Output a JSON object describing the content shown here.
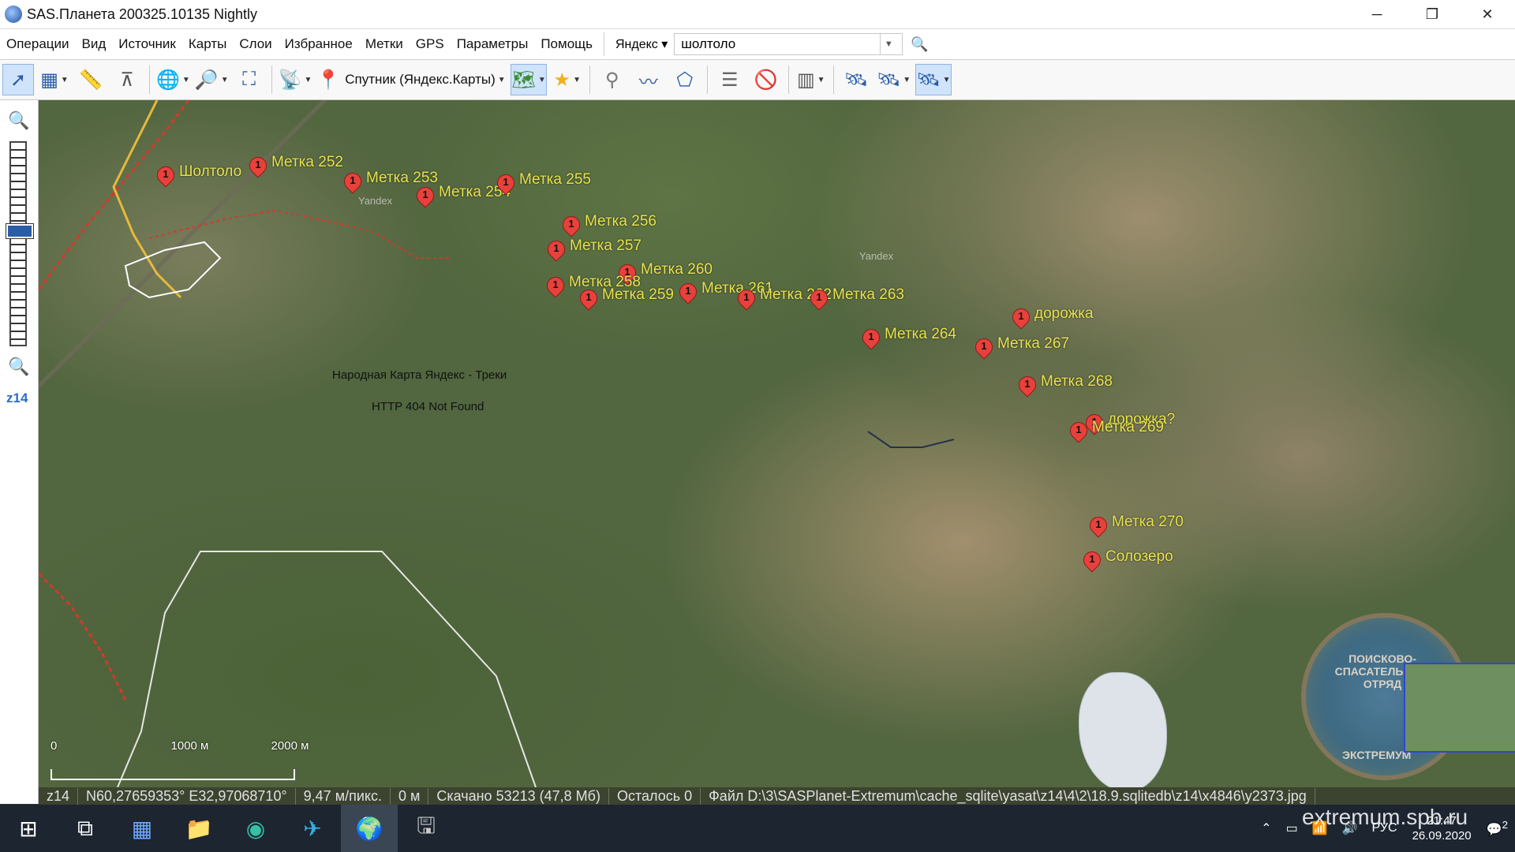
{
  "window": {
    "title": "SAS.Планета 200325.10135 Nightly",
    "minimize": "─",
    "restore": "❐",
    "close": "✕"
  },
  "menu": {
    "items": [
      "Операции",
      "Вид",
      "Источник",
      "Карты",
      "Слои",
      "Избранное",
      "Метки",
      "GPS",
      "Параметры",
      "Помощь"
    ]
  },
  "search": {
    "provider": "Яндекс",
    "value": "шолтоло",
    "go_icon": "🔍"
  },
  "toolbar": {
    "map_source": "Спутник (Яндекс.Карты)"
  },
  "zoom": {
    "level_label": "z14",
    "zoom_in": "🔍",
    "zoom_out": "🔍"
  },
  "map": {
    "overlay_text_1": "Народная Карта Яндекс - Треки",
    "overlay_text_2": "HTTP 404 Not Found",
    "watermark_1": "Yandex",
    "watermark_2": "Yandex",
    "scale": {
      "zero": "0",
      "mid": "1000 м",
      "end": "2000 м"
    },
    "emblem_top": "ПОИСКОВО-СПАСАТЕЛЬНЫЙ ОТРЯД",
    "emblem_bottom": "ЭКСТРЕМУМ",
    "markers": [
      {
        "pin": "1",
        "label": "Шолтоло"
      },
      {
        "pin": "1",
        "label": "Метка 252"
      },
      {
        "pin": "1",
        "label": "Метка 253"
      },
      {
        "pin": "1",
        "label": "Метка 254"
      },
      {
        "pin": "1",
        "label": "Метка 255"
      },
      {
        "pin": "1",
        "label": "Метка 256"
      },
      {
        "pin": "1",
        "label": "Метка 257"
      },
      {
        "pin": "1",
        "label": "Метка 260"
      },
      {
        "pin": "1",
        "label": "Метка 258"
      },
      {
        "pin": "1",
        "label": "Метка 259"
      },
      {
        "pin": "1",
        "label": "Метка 261"
      },
      {
        "pin": "1",
        "label": "Метка 262"
      },
      {
        "pin": "1",
        "label": "Метка 263"
      },
      {
        "pin": "1",
        "label": "дорожка"
      },
      {
        "pin": "1",
        "label": "Метка 264"
      },
      {
        "pin": "1",
        "label": "Метка 267"
      },
      {
        "pin": "1",
        "label": "Метка 268"
      },
      {
        "pin": "1",
        "label": "дорожка?"
      },
      {
        "pin": "1",
        "label": "Метка 269"
      },
      {
        "pin": "1",
        "label": "Метка 270"
      },
      {
        "pin": "1",
        "label": "Солозеро"
      }
    ]
  },
  "status": {
    "zoom": "z14",
    "coords": "N60,27659353° E32,97068710°",
    "resolution": "9,47 м/пикс.",
    "distance": "0 м",
    "downloaded": "Скачано 53213 (47,8 Мб)",
    "remaining": "Осталось 0",
    "file": "Файл D:\\3\\SASPlanet-Extremum\\cache_sqlite\\yasat\\z14\\4\\2\\18.9.sqlitedb\\z14\\x4846\\y2373.jpg"
  },
  "taskbar": {
    "apps": [
      "start-icon",
      "task-view-icon",
      "calculator-icon",
      "file-explorer-icon",
      "edge-icon",
      "telegram-icon",
      "sasplanet-icon",
      "tool-icon"
    ],
    "tray_lang": "РУС",
    "time": "21:47",
    "date": "26.09.2020",
    "notifications": "2"
  },
  "site_watermark": "extremum.spb.ru"
}
